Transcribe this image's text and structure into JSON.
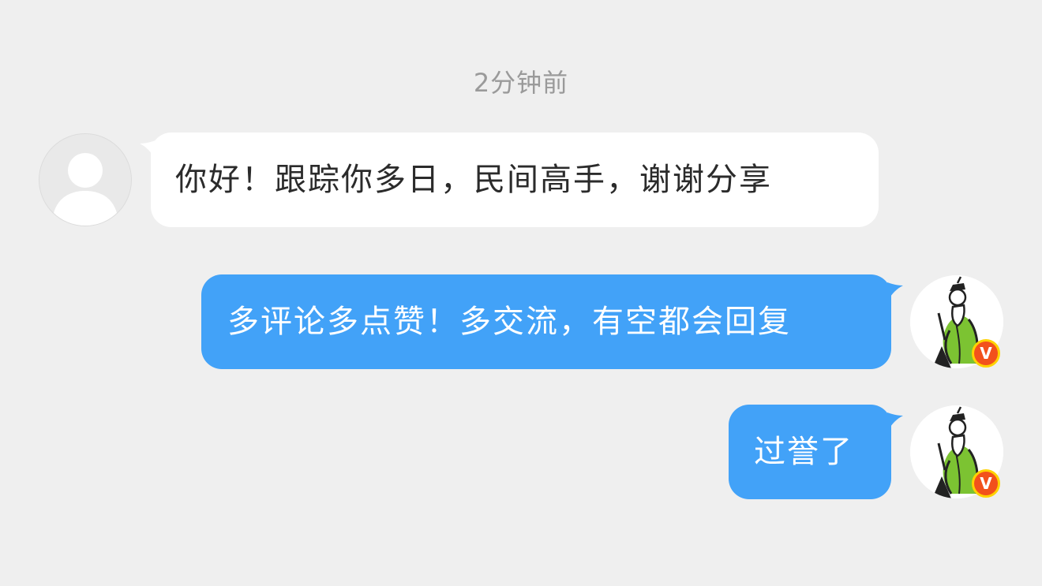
{
  "conversation": {
    "timestamp": "2分钟前",
    "messages": [
      {
        "direction": "incoming",
        "text": "你好！跟踪你多日，民间高手，谢谢分享",
        "avatar": "default-user-avatar"
      },
      {
        "direction": "outgoing",
        "text": "多评论多点赞！多交流，有空都会回复",
        "avatar": "sage-illustration-avatar",
        "verified": true
      },
      {
        "direction": "outgoing",
        "text": "过誉了",
        "avatar": "sage-illustration-avatar",
        "verified": true
      }
    ]
  },
  "badge": {
    "label": "V",
    "icon": "verified-badge-icon"
  },
  "colors": {
    "background": "#efefef",
    "incoming_bubble": "#ffffff",
    "outgoing_bubble": "#42a2f8",
    "timestamp_text": "#9a9a9a",
    "badge_outer": "#ffd200",
    "badge_inner": "#f2511c"
  }
}
